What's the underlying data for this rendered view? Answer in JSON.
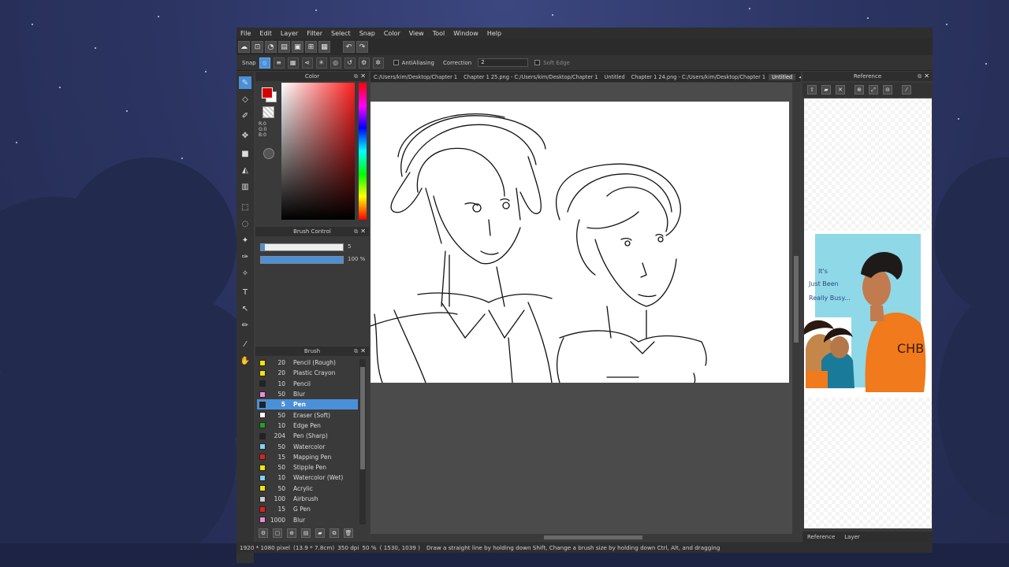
{
  "menu": [
    "File",
    "Edit",
    "Layer",
    "Filter",
    "Select",
    "Snap",
    "Color",
    "View",
    "Tool",
    "Window",
    "Help"
  ],
  "snapbar": {
    "snap_label": "Snap",
    "antialiasing_label": "AntiAliasing",
    "correction_label": "Correction",
    "correction_value": "2",
    "soft_edge_label": "Soft Edge"
  },
  "color_panel": {
    "title": "Color",
    "r": "R:0",
    "g": "G:0",
    "b": "B:0"
  },
  "brush_control": {
    "title": "Brush Control",
    "size_value": "5",
    "opacity_value": "100 %",
    "size_fraction": 0.05,
    "opacity_fraction": 1.0
  },
  "brush_panel": {
    "title": "Brush",
    "items": [
      {
        "size": "20",
        "name": "Pencil (Rough)",
        "color": "#f2e600"
      },
      {
        "size": "20",
        "name": "Plastic Crayon",
        "color": "#f2e600"
      },
      {
        "size": "10",
        "name": "Pencil",
        "color": "#222222"
      },
      {
        "size": "50",
        "name": "Blur",
        "color": "#f08ad8"
      },
      {
        "size": "5",
        "name": "Pen",
        "color": "#222222",
        "selected": true
      },
      {
        "size": "50",
        "name": "Eraser (Soft)",
        "color": "#ffffff"
      },
      {
        "size": "10",
        "name": "Edge Pen",
        "color": "#1fa31f"
      },
      {
        "size": "204",
        "name": "Pen (Sharp)",
        "color": "#222222"
      },
      {
        "size": "50",
        "name": "Watercolor",
        "color": "#7fd3f5"
      },
      {
        "size": "15",
        "name": "Mapping Pen",
        "color": "#e02020"
      },
      {
        "size": "50",
        "name": "Stipple Pen",
        "color": "#f2e600"
      },
      {
        "size": "10",
        "name": "Watercolor (Wet)",
        "color": "#7fd3f5"
      },
      {
        "size": "50",
        "name": "Acrylic",
        "color": "#f2e600"
      },
      {
        "size": "100",
        "name": "Airbrush",
        "color": "#cccccc"
      },
      {
        "size": "15",
        "name": "G Pen",
        "color": "#e02020"
      },
      {
        "size": "1000",
        "name": "Blur",
        "color": "#f08ad8"
      }
    ]
  },
  "tabs": [
    {
      "label": "C:/Users/kim/Desktop/Chapter 1"
    },
    {
      "label": "Chapter 1 25.png - C:/Users/kim/Desktop/Chapter 1"
    },
    {
      "label": "Untitled"
    },
    {
      "label": "Chapter 1 24.png - C:/Users/kim/Desktop/Chapter 1"
    },
    {
      "label": "Untitled",
      "current": true
    }
  ],
  "reference": {
    "title": "Reference",
    "tab_reference": "Reference",
    "tab_layer": "Layer",
    "speech_line1": "It's",
    "speech_line2": "Just Been",
    "speech_line3": "Really Busy...",
    "shirt_text": "CHB"
  },
  "status": {
    "size": "1920 * 1080 pixel",
    "physical": "(13.9 * 7.8cm)",
    "dpi": "350 dpi",
    "zoom": "50 %",
    "cursor": "( 1530, 1039 )",
    "hint": "Draw a straight line by holding down Shift, Change a brush size by holding down Ctrl, Alt, and dragging"
  }
}
